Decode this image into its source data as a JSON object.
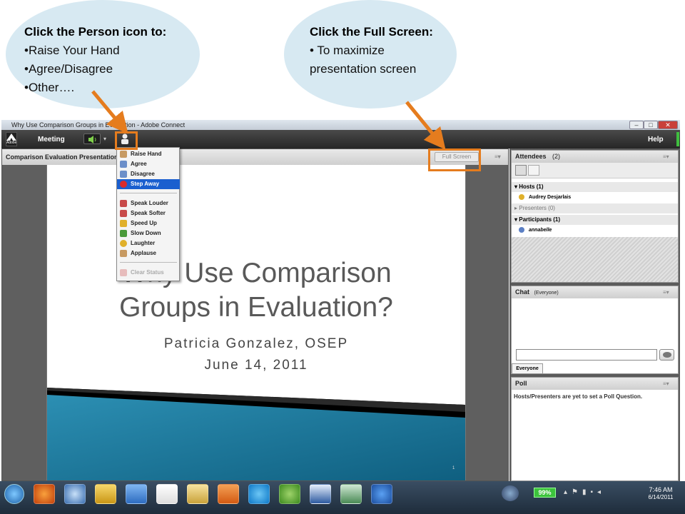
{
  "callouts": {
    "person": {
      "title": "Click the Person icon to:",
      "items": [
        "•Raise Your Hand",
        "•Agree/Disagree",
        "•Other…."
      ]
    },
    "fullscreen": {
      "title": "Click the Full Screen:",
      "items": [
        "• To maximize",
        "presentation screen"
      ]
    }
  },
  "window": {
    "title": "Why Use Comparison Groups in Evaluation - Adobe Connect",
    "controls": [
      "–",
      "□",
      "✕"
    ]
  },
  "menubar": {
    "logo": "Adobe",
    "meeting": "Meeting",
    "help": "Help"
  },
  "share_pod": {
    "title": "Comparison Evaluation Presentation",
    "fullscreen_button": "Full Screen",
    "menu_glyph": "≡▾"
  },
  "status_menu": {
    "items": [
      {
        "label": "Raise Hand",
        "color": "#b08a5a"
      },
      {
        "label": "Agree",
        "color": "#6c8fc9"
      },
      {
        "label": "Disagree",
        "color": "#6c8fc9"
      },
      {
        "label": "Step Away",
        "color": "#d92b2b",
        "selected": true
      },
      {
        "label": "Speak Louder",
        "color": "#c84a4a"
      },
      {
        "label": "Speak Softer",
        "color": "#c84a4a"
      },
      {
        "label": "Speed Up",
        "color": "#e0b02a"
      },
      {
        "label": "Slow Down",
        "color": "#4a9a3a"
      },
      {
        "label": "Laughter",
        "color": "#e0b02a"
      },
      {
        "label": "Applause",
        "color": "#b08a5a"
      }
    ],
    "clear": "Clear Status"
  },
  "slide": {
    "title_line1": "Why Use Comparison",
    "title_line2": "Groups in Evaluation?",
    "author": "Patricia Gonzalez, OSEP",
    "date": "June 14, 2011",
    "page": "1"
  },
  "attendees": {
    "title": "Attendees",
    "count": "(2)",
    "hosts": "Hosts (1)",
    "host_name": "Audrey Desjarlais",
    "presenters": "Presenters (0)",
    "participants": "Participants (1)",
    "participant_name": "annabelle"
  },
  "chat": {
    "title": "Chat",
    "scope": "(Everyone)",
    "tab": "Everyone"
  },
  "poll": {
    "title": "Poll",
    "message": "Hosts/Presenters are yet to set a Poll Question."
  },
  "taskbar": {
    "battery": "99%",
    "time": "7:46 AM",
    "date": "6/14/2011"
  },
  "colors": {
    "accent_orange": "#e57c1e",
    "bubble": "#d7e9f2",
    "selection_blue": "#1a5fcf"
  }
}
